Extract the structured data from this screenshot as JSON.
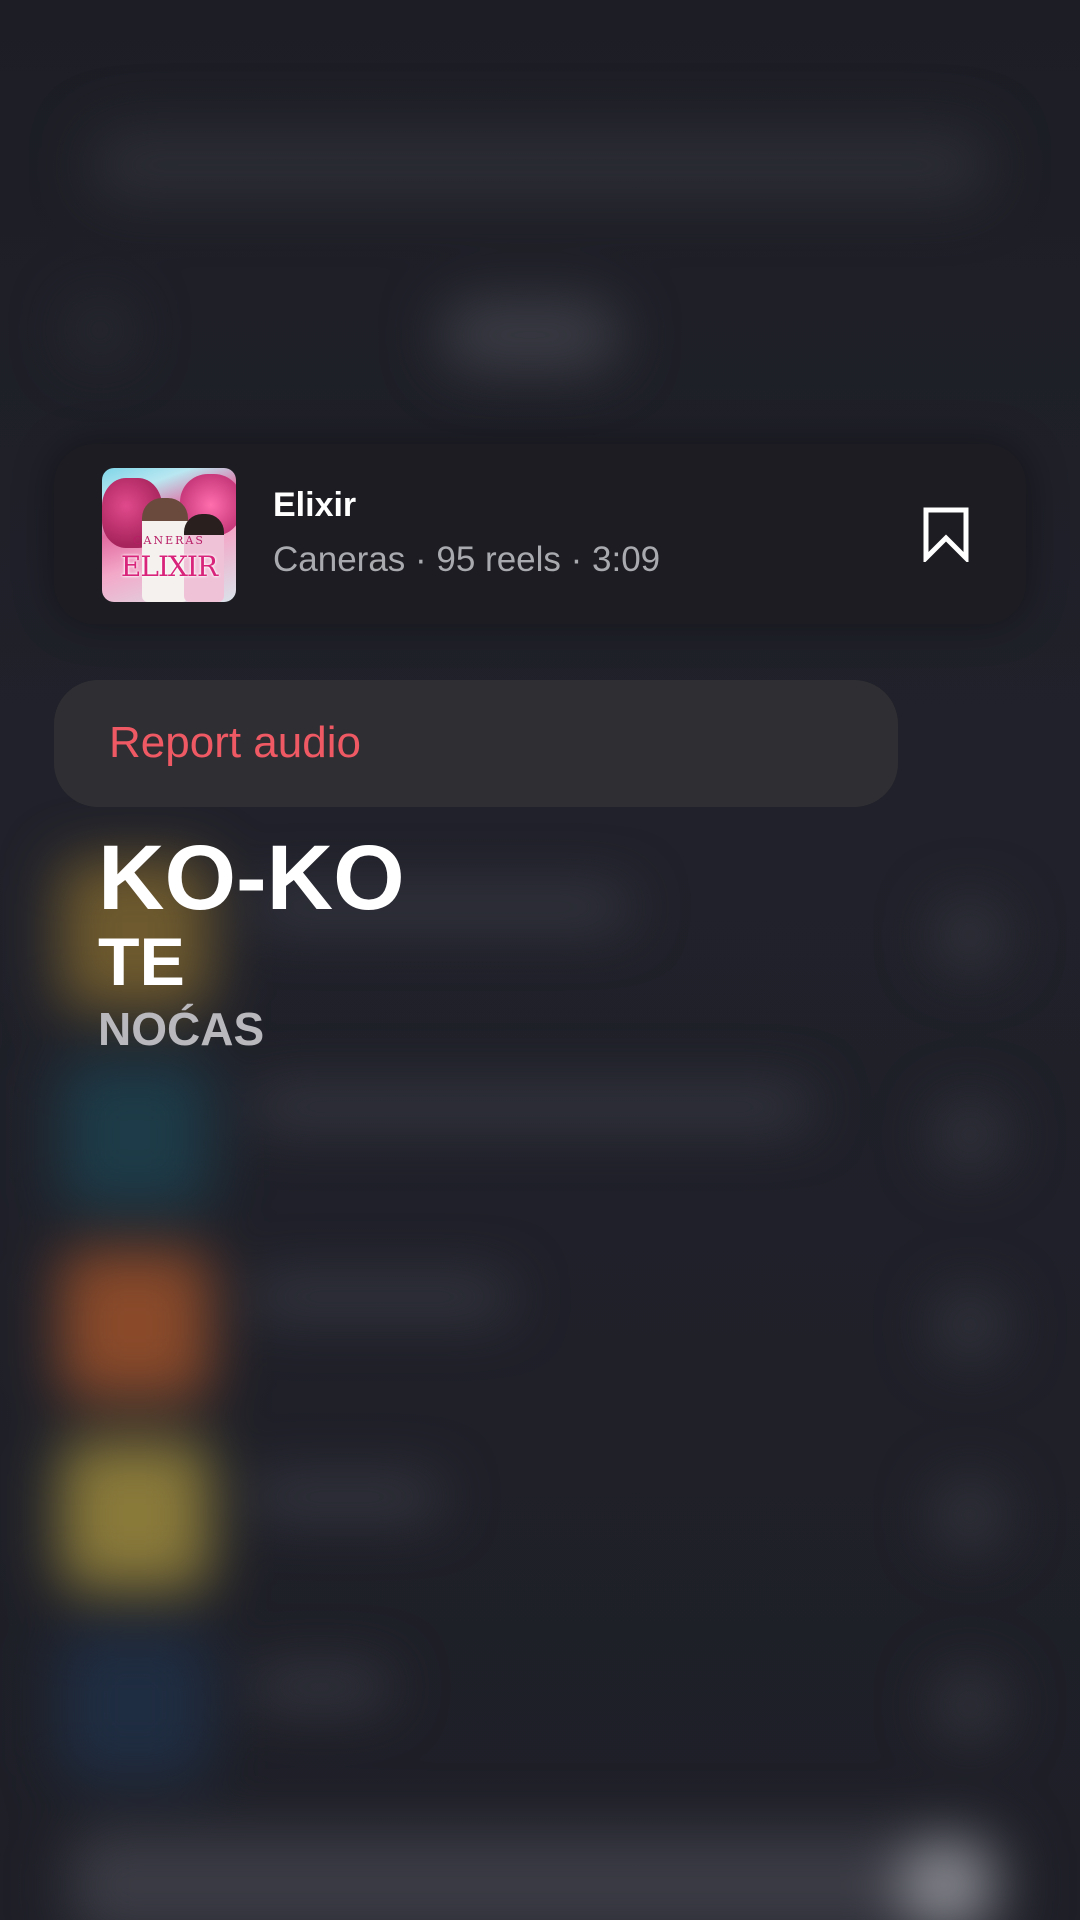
{
  "song": {
    "title": "Elixir",
    "meta": "Caneras · 95 reels · 3:09",
    "art_artist": "CANERAS",
    "art_title": "ELIXIR"
  },
  "menu": {
    "report_label": "Report audio",
    "report_color": "#ef5963"
  },
  "hero": {
    "line1": "KO-KO",
    "line2": "TE",
    "line3": "NOĆAS"
  },
  "icons": {
    "save": "bookmark-icon"
  }
}
